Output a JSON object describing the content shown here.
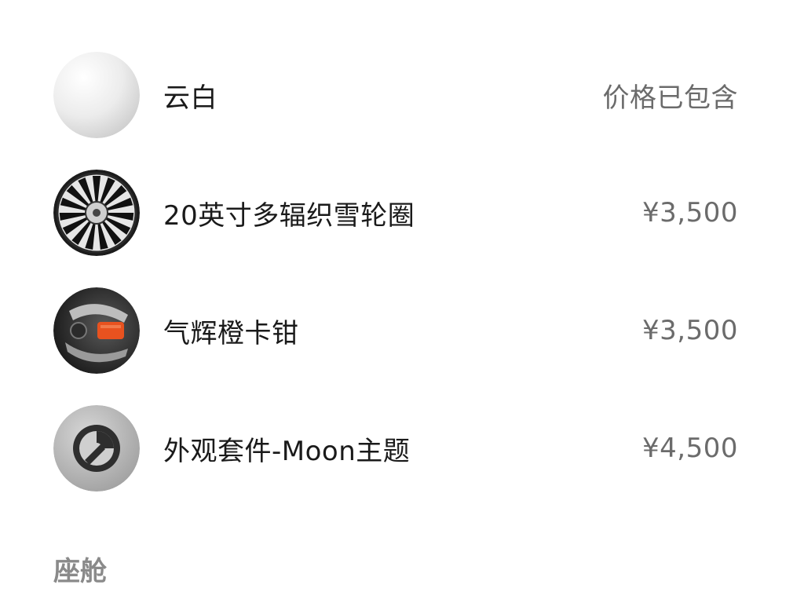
{
  "options": [
    {
      "name": "云白",
      "price": "价格已包含",
      "icon": "white-paint-swatch-icon"
    },
    {
      "name": "20英寸多辐织雪轮圈",
      "price": "¥3,500",
      "icon": "wheel-rim-icon"
    },
    {
      "name": "气辉橙卡钳",
      "price": "¥3,500",
      "icon": "orange-brake-caliper-icon"
    },
    {
      "name": "外观套件-Moon主题",
      "price": "¥4,500",
      "icon": "moon-theme-kit-icon"
    }
  ],
  "section": {
    "title": "座舱"
  },
  "colors": {
    "label": "#1a1a1a",
    "price": "#6b6b6b",
    "section_title": "#8a8a8a",
    "caliper_accent": "#e8521f"
  }
}
